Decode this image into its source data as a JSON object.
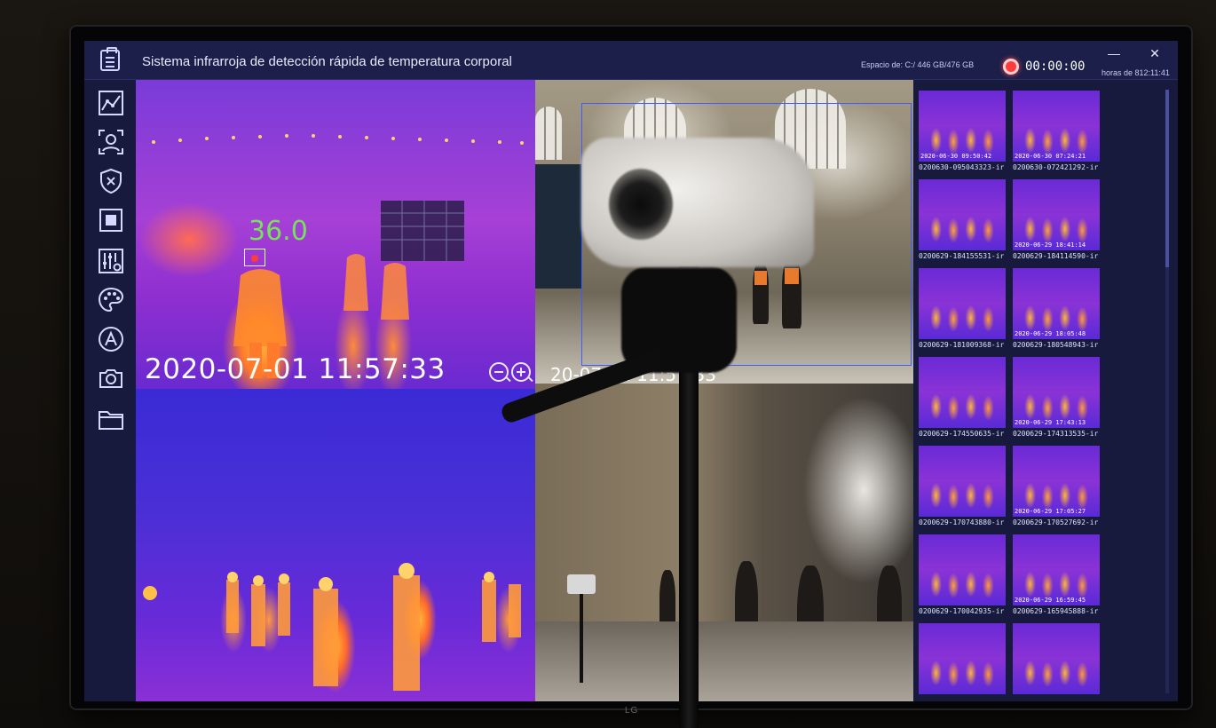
{
  "app": {
    "title": "Sistema infrarroja de detección rápida de temperatura corporal",
    "disk_info": "Espacio de: C:/ 446 GB/476 GB",
    "record_time": "00:00:00",
    "hours_info": "horas de 812:11:41",
    "minimize_label": "—",
    "close_label": "✕"
  },
  "brand": "LG",
  "sidebar": {
    "items": [
      {
        "name": "area-chart-icon"
      },
      {
        "name": "face-detect-icon"
      },
      {
        "name": "shield-x-icon"
      },
      {
        "name": "stop-square-icon"
      },
      {
        "name": "settings-sliders-icon"
      },
      {
        "name": "palette-icon"
      },
      {
        "name": "letter-a-icon"
      },
      {
        "name": "camera-icon"
      },
      {
        "name": "folder-icon"
      }
    ]
  },
  "thermal_view": {
    "temperature": "36.0",
    "timestamp": "2020-07-01 11:57:33"
  },
  "visible_view": {
    "timestamp_partial": "20-07-01 11:57:33"
  },
  "snapshots": [
    {
      "stamp": "2020-06-30 09:50:42",
      "name": "0200630-095043323-ir"
    },
    {
      "stamp": "2020-06-30 07:24:21",
      "name": "0200630-072421292-ir"
    },
    {
      "stamp": "",
      "name": "0200629-184155531-ir"
    },
    {
      "stamp": "2020-06-29 18:41:14",
      "name": "0200629-184114590-ir"
    },
    {
      "stamp": "",
      "name": "0200629-181009368-ir"
    },
    {
      "stamp": "2020-06-29 18:05:48",
      "name": "0200629-180548943-ir"
    },
    {
      "stamp": "",
      "name": "0200629-174550635-ir"
    },
    {
      "stamp": "2020-06-29 17:43:13",
      "name": "0200629-174313535-ir"
    },
    {
      "stamp": "",
      "name": "0200629-170743880-ir"
    },
    {
      "stamp": "2020-06-29 17:05:27",
      "name": "0200629-170527692-ir"
    },
    {
      "stamp": "",
      "name": "0200629-170042935-ir"
    },
    {
      "stamp": "2020-06-29 16:59:45",
      "name": "0200629-165945888-ir"
    },
    {
      "stamp": "",
      "name": ""
    },
    {
      "stamp": "",
      "name": ""
    }
  ],
  "colors": {
    "screen_bg": "#171a3d",
    "temperature_text": "#78e05a",
    "roi_box": "#3f5cff",
    "record_dot": "#ff3b3b"
  }
}
